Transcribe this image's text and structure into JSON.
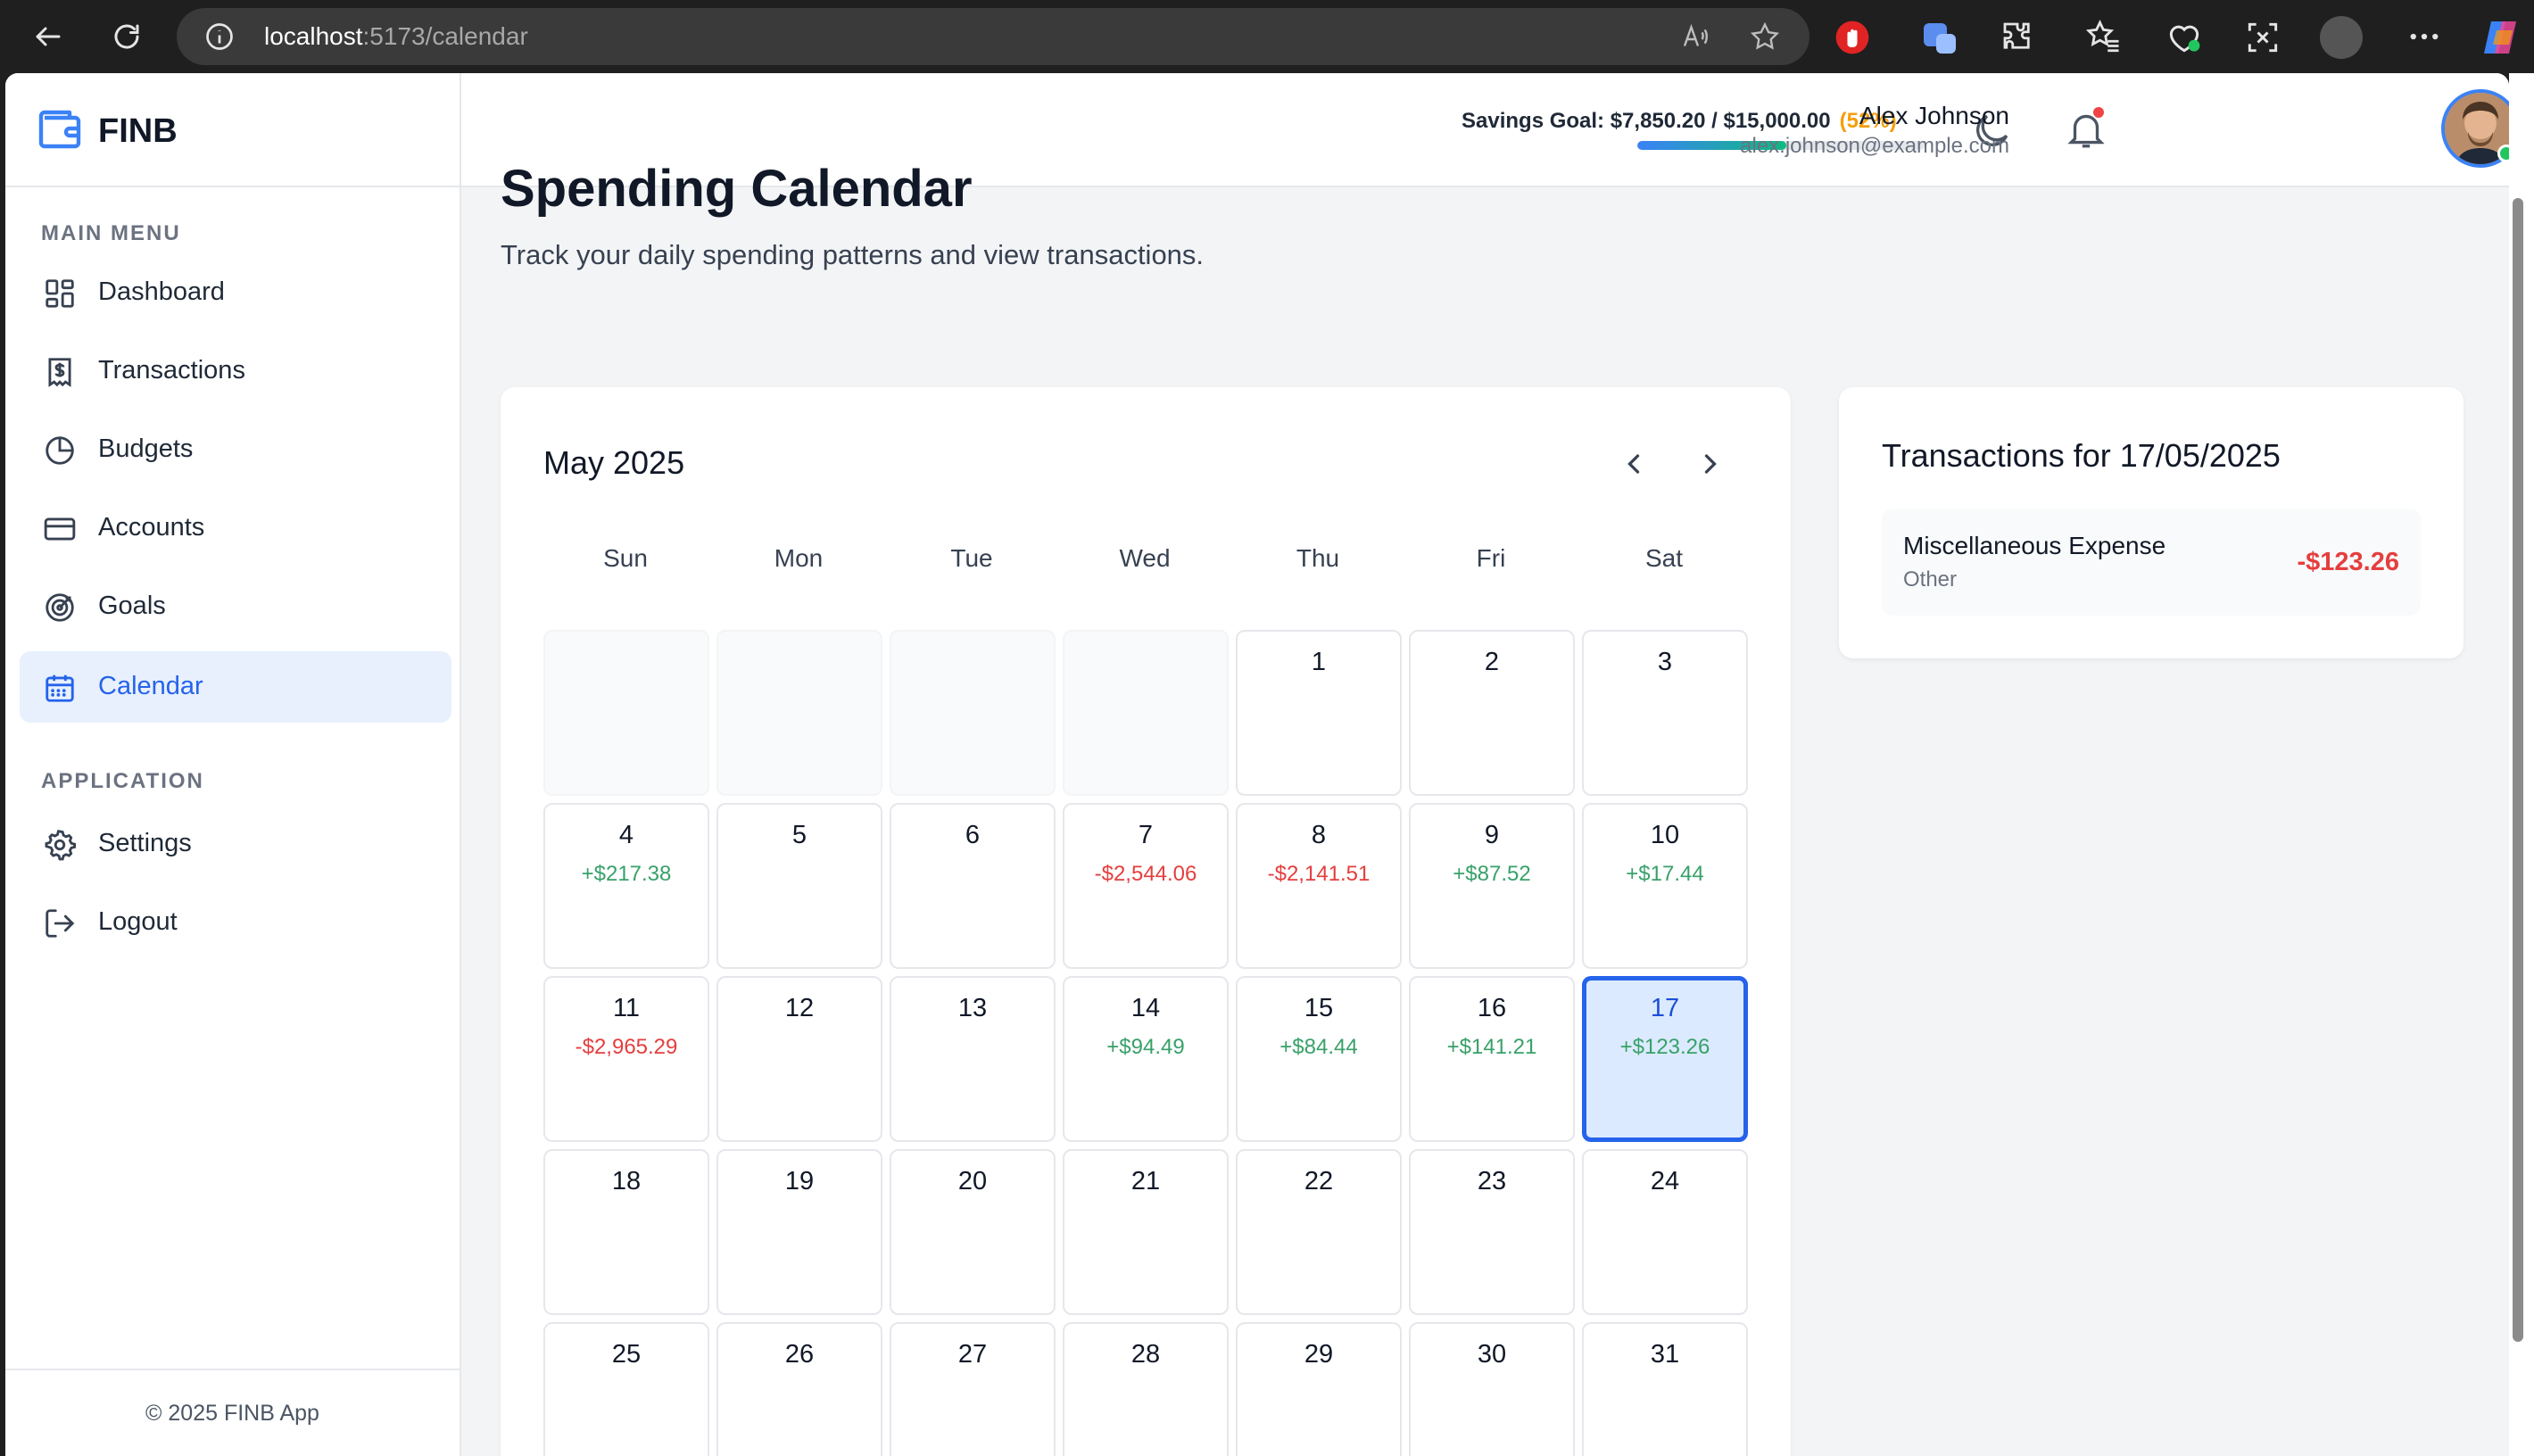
{
  "browser": {
    "url_host": "localhost",
    "url_path": ":5173/calendar"
  },
  "sidebar": {
    "brand": "FINB",
    "main_menu_title": "MAIN MENU",
    "items": [
      {
        "label": "Dashboard",
        "icon": "dashboard-icon"
      },
      {
        "label": "Transactions",
        "icon": "receipt-dollar-icon"
      },
      {
        "label": "Budgets",
        "icon": "pie-chart-icon"
      },
      {
        "label": "Accounts",
        "icon": "credit-card-icon"
      },
      {
        "label": "Goals",
        "icon": "target-icon"
      },
      {
        "label": "Calendar",
        "icon": "calendar-icon",
        "active": true
      }
    ],
    "application_title": "APPLICATION",
    "app_items": [
      {
        "label": "Settings",
        "icon": "gear-icon"
      },
      {
        "label": "Logout",
        "icon": "logout-icon"
      }
    ],
    "footer": "© 2025 FINB App"
  },
  "header": {
    "savings_label": "Savings Goal: $7,850.20 / $15,000.00",
    "savings_pct": "(52%)",
    "savings_progress": 0.52,
    "user_name": "Alex Johnson",
    "user_email": "alex.johnson@example.com"
  },
  "page": {
    "title": "Spending Calendar",
    "subtitle": "Track your daily spending patterns and view transactions."
  },
  "calendar": {
    "month": "May 2025",
    "weekdays": [
      "Sun",
      "Mon",
      "Tue",
      "Wed",
      "Thu",
      "Fri",
      "Sat"
    ],
    "leading_blanks": 4,
    "days": [
      {
        "d": "1"
      },
      {
        "d": "2"
      },
      {
        "d": "3"
      },
      {
        "d": "4",
        "amt": "+$217.38",
        "type": "pos"
      },
      {
        "d": "5"
      },
      {
        "d": "6"
      },
      {
        "d": "7",
        "amt": "-$2,544.06",
        "type": "neg"
      },
      {
        "d": "8",
        "amt": "-$2,141.51",
        "type": "neg"
      },
      {
        "d": "9",
        "amt": "+$87.52",
        "type": "pos"
      },
      {
        "d": "10",
        "amt": "+$17.44",
        "type": "pos"
      },
      {
        "d": "11",
        "amt": "-$2,965.29",
        "type": "neg"
      },
      {
        "d": "12"
      },
      {
        "d": "13"
      },
      {
        "d": "14",
        "amt": "+$94.49",
        "type": "pos"
      },
      {
        "d": "15",
        "amt": "+$84.44",
        "type": "pos"
      },
      {
        "d": "16",
        "amt": "+$141.21",
        "type": "pos"
      },
      {
        "d": "17",
        "amt": "+$123.26",
        "type": "pos",
        "selected": true
      },
      {
        "d": "18"
      },
      {
        "d": "19"
      },
      {
        "d": "20"
      },
      {
        "d": "21"
      },
      {
        "d": "22"
      },
      {
        "d": "23"
      },
      {
        "d": "24"
      },
      {
        "d": "25"
      },
      {
        "d": "26"
      },
      {
        "d": "27"
      },
      {
        "d": "28"
      },
      {
        "d": "29"
      },
      {
        "d": "30"
      },
      {
        "d": "31"
      }
    ]
  },
  "transactions": {
    "title": "Transactions for 17/05/2025",
    "items": [
      {
        "name": "Miscellaneous Expense",
        "category": "Other",
        "amount": "-$123.26"
      }
    ]
  },
  "colors": {
    "accent": "#2563eb",
    "positive": "#38a169",
    "negative": "#e53e3e",
    "warning": "#f59e0b"
  }
}
